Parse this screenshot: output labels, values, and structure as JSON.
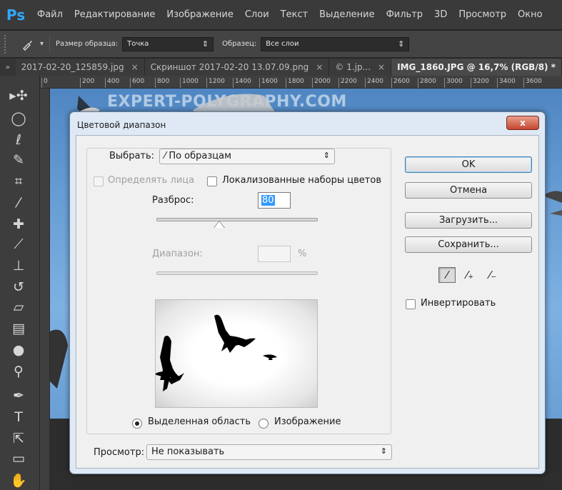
{
  "app": {
    "logo": "Ps",
    "menu": [
      "Файл",
      "Редактирование",
      "Изображение",
      "Слои",
      "Текст",
      "Выделение",
      "Фильтр",
      "3D",
      "Просмотр",
      "Окно"
    ]
  },
  "options_bar": {
    "sample_size_label": "Размер образца:",
    "sample_size_value": "Точка",
    "sample_label": "Образец:",
    "sample_value": "Все слои"
  },
  "tabs": [
    {
      "label": "2017-02-20_125859.jpg",
      "close": "×"
    },
    {
      "label": "Скриншот 2017-02-20 13.07.09.png",
      "close": "×"
    },
    {
      "label": "© 1.jp...",
      "close": "×"
    },
    {
      "label": "IMG_1860.JPG @ 16,7% (RGB/8) *",
      "close": ""
    }
  ],
  "ruler_ticks": [
    "0",
    "200",
    "400",
    "600",
    "800",
    "1000",
    "1200",
    "1400",
    "1600",
    "1800",
    "2000",
    "2200",
    "2400",
    "2600",
    "2800",
    "3000",
    "3200",
    "3400",
    "3600"
  ],
  "canvas": {
    "watermark": "EXPERT-POLYGRAPHY.COM"
  },
  "dialog": {
    "title": "Цветовой диапазон",
    "close_label": "x",
    "select_label": "Выбрать:",
    "select_value": "По образцам",
    "detect_faces_label": "Определять лица",
    "localized_label": "Локализованные наборы цветов",
    "fuzziness_label": "Разброс:",
    "fuzziness_value": "80",
    "fuzziness_level": 0.39,
    "range_label": "Диапазон:",
    "range_unit": "%",
    "selection_label": "Выделенная область",
    "image_label": "Изображение",
    "preview_label": "Просмотр:",
    "preview_value": "Не показывать",
    "ok_label": "OK",
    "cancel_label": "Отмена",
    "load_label": "Загрузить...",
    "save_label": "Сохранить...",
    "invert_label": "Инвертировать"
  }
}
